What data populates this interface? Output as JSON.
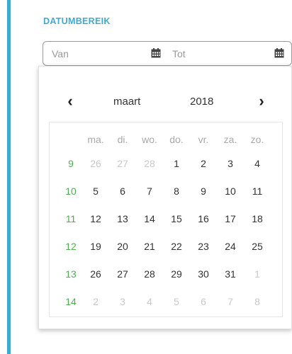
{
  "filter": {
    "section_label": "DATUMBEREIK",
    "from_placeholder": "Van",
    "to_placeholder": "Tot"
  },
  "calendar": {
    "month": "maart",
    "year": "2018",
    "prev_arrow": "‹",
    "next_arrow": "›",
    "weekdays": [
      "ma.",
      "di.",
      "wo.",
      "do.",
      "vr.",
      "za.",
      "zo."
    ],
    "weeks": [
      {
        "number": "9",
        "days": [
          [
            "26",
            true
          ],
          [
            "27",
            true
          ],
          [
            "28",
            true
          ],
          [
            "1",
            false
          ],
          [
            "2",
            false
          ],
          [
            "3",
            false
          ],
          [
            "4",
            false
          ]
        ]
      },
      {
        "number": "10",
        "days": [
          [
            "5",
            false
          ],
          [
            "6",
            false
          ],
          [
            "7",
            false
          ],
          [
            "8",
            false
          ],
          [
            "9",
            false
          ],
          [
            "10",
            false
          ],
          [
            "11",
            false
          ]
        ]
      },
      {
        "number": "11",
        "days": [
          [
            "12",
            false
          ],
          [
            "13",
            false
          ],
          [
            "14",
            false
          ],
          [
            "15",
            false
          ],
          [
            "16",
            false
          ],
          [
            "17",
            false
          ],
          [
            "18",
            false
          ]
        ]
      },
      {
        "number": "12",
        "days": [
          [
            "19",
            false
          ],
          [
            "20",
            false
          ],
          [
            "21",
            false
          ],
          [
            "22",
            false
          ],
          [
            "23",
            false
          ],
          [
            "24",
            false
          ],
          [
            "25",
            false
          ]
        ]
      },
      {
        "number": "13",
        "days": [
          [
            "26",
            false
          ],
          [
            "27",
            false
          ],
          [
            "28",
            false
          ],
          [
            "29",
            false
          ],
          [
            "30",
            false
          ],
          [
            "31",
            false
          ],
          [
            "1",
            true
          ]
        ]
      },
      {
        "number": "14",
        "days": [
          [
            "2",
            true
          ],
          [
            "3",
            true
          ],
          [
            "4",
            true
          ],
          [
            "5",
            true
          ],
          [
            "6",
            true
          ],
          [
            "7",
            true
          ],
          [
            "8",
            true
          ]
        ]
      }
    ]
  },
  "icons": {
    "calendar": "calendar-icon",
    "prev": "chevron-left-icon",
    "next": "chevron-right-icon"
  },
  "colors": {
    "accent": "#3fa9d4",
    "week_number": "#4caf50",
    "muted_day": "#c8c8c8"
  }
}
